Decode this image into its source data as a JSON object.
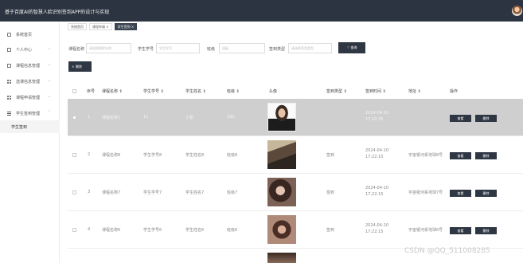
{
  "header": {
    "title": "基于百度AI的智慧人脸识别签到APP的设计与实现"
  },
  "sidebar": {
    "items": [
      {
        "label": "系统首页"
      },
      {
        "label": "个人中心"
      },
      {
        "label": "课程信息管理"
      },
      {
        "label": "选课信息管理"
      },
      {
        "label": "课程申请管理"
      },
      {
        "label": "学生签到管理"
      },
      {
        "label": "学生签到"
      }
    ]
  },
  "tabs": [
    {
      "label": "系统首页"
    },
    {
      "label": "课程申请 ×"
    },
    {
      "label": "学生签到 ×"
    }
  ],
  "search": {
    "course_label": "课程名称",
    "course_placeholder": "请选择课程名称",
    "student_id_label": "学生学号",
    "student_id_placeholder": "学生学号",
    "class_label": "班级",
    "class_placeholder": "班级",
    "type_label": "签到类型",
    "type_placeholder": "请选择签到类型",
    "button": "查询"
  },
  "toolbar": {
    "delete_label": "删除",
    "delete_icon": "×"
  },
  "table": {
    "headers": [
      "序号",
      "课程名称 ⇕",
      "学生学号 ⇕",
      "学生姓名 ⇕",
      "班级 ⇕",
      "头像",
      "签到类型 ⇕",
      "签到时间 ⇕",
      "地址 ⇕",
      "操作"
    ],
    "rows": [
      {
        "index": "1",
        "course": "课程名称1",
        "student_id": "11",
        "name": "小张",
        "class": "192",
        "type": "",
        "time": "2024-04-10 17:20:35",
        "address": ""
      },
      {
        "index": "2",
        "course": "课程名称8",
        "student_id": "学生学号8",
        "name": "学生姓名8",
        "class": "班级8",
        "type": "签到",
        "time": "2024-04-10 17:22:15",
        "address": "宇宙银河系地球8号"
      },
      {
        "index": "3",
        "course": "课程名称7",
        "student_id": "学生学号7",
        "name": "学生姓名7",
        "class": "班级7",
        "type": "签到",
        "time": "2024-04-10 17:22:15",
        "address": "宇宙银河系地球7号"
      },
      {
        "index": "4",
        "course": "课程名称6",
        "student_id": "学生学号6",
        "name": "学生姓名6",
        "class": "班级6",
        "type": "签到",
        "time": "2024-04-10 17:22:15",
        "address": "宇宙银河系地球6号"
      }
    ],
    "view_label": "查看",
    "delete_label": "删除"
  },
  "watermark": "CSDN @QQ_511008285"
}
